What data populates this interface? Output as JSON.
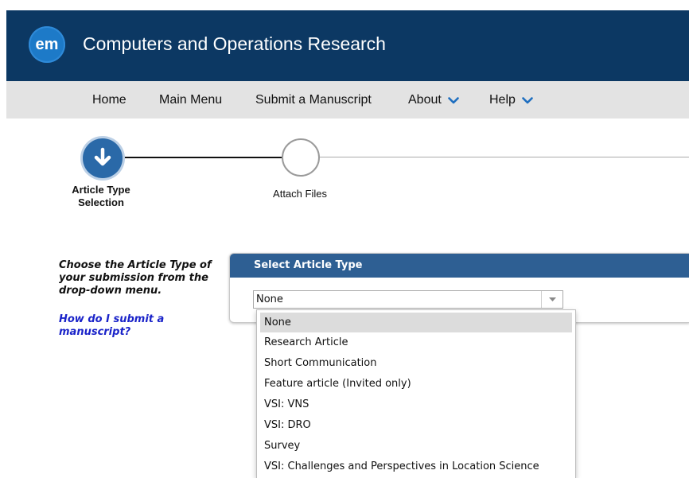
{
  "header": {
    "logo_text": "em",
    "journal_title": "Computers and Operations Research"
  },
  "nav": {
    "home": "Home",
    "main_menu": "Main Menu",
    "submit": "Submit a Manuscript",
    "about": "About",
    "help": "Help"
  },
  "steps": {
    "current_label_line1": "Article Type",
    "current_label_line2": "Selection",
    "next_label": "Attach Files"
  },
  "sidebar": {
    "instruction": "Choose the Article Type of your submission from the drop-down menu.",
    "help_link": "How do I submit a manuscript?"
  },
  "panel": {
    "title": "Select Article Type",
    "selected_value": "None",
    "options": [
      "None",
      "Research Article",
      "Short Communication",
      "Feature article (Invited only)",
      "VSI: VNS",
      "VSI: DRO",
      "Survey",
      "VSI: Challenges and Perspectives in Location Science"
    ]
  },
  "colors": {
    "header_bg": "#0c3863",
    "nav_bg": "#e3e3e3",
    "accent": "#2a69a8",
    "panel_header": "#2e5f93",
    "link": "#1a23c9"
  }
}
